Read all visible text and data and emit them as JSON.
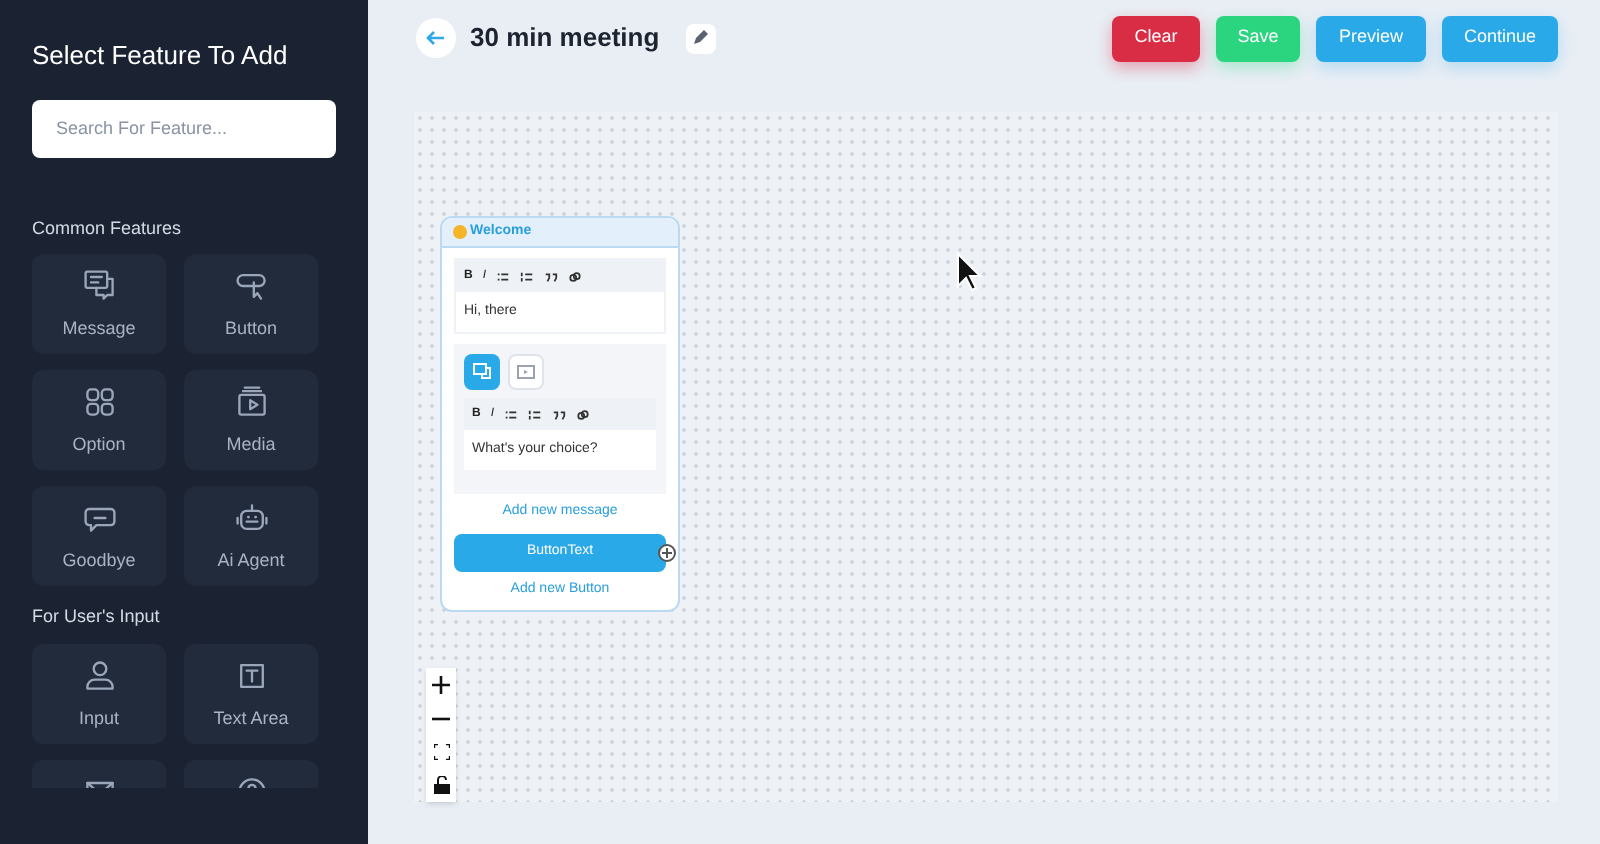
{
  "sidebar": {
    "title": "Select Feature To Add",
    "search": {
      "placeholder": "Search For Feature..."
    },
    "sections": [
      {
        "title": "Common Features",
        "items": [
          {
            "label": "Message",
            "kind": "message"
          },
          {
            "label": "Button",
            "kind": "button"
          },
          {
            "label": "Option",
            "kind": "option"
          },
          {
            "label": "Media",
            "kind": "media"
          },
          {
            "label": "Goodbye",
            "kind": "goodbye"
          },
          {
            "label": "Ai Agent",
            "kind": "agent"
          }
        ]
      },
      {
        "title": "For User's Input",
        "items": [
          {
            "label": "Input",
            "kind": "input"
          },
          {
            "label": "Text Area",
            "kind": "textarea"
          },
          {
            "kind": "email"
          },
          {
            "kind": "question"
          }
        ]
      }
    ]
  },
  "header": {
    "title": "30 min meeting",
    "buttons": [
      {
        "label": "Clear",
        "kind": "danger"
      },
      {
        "label": "Save",
        "kind": "success"
      },
      {
        "label": "Preview",
        "kind": "primary"
      },
      {
        "label": "Continue",
        "kind": "primary"
      }
    ]
  },
  "node": {
    "title": "Welcome",
    "editor": {
      "tools": [
        "B",
        "I"
      ],
      "text": "Hi, there"
    },
    "tabs": [
      {
        "kind": "message",
        "selected": true
      },
      {
        "kind": "media",
        "selected": false
      }
    ],
    "inner_editor": {
      "tools": [
        "B",
        "I"
      ],
      "text": "What's your choice?"
    },
    "add_message": "Add new message",
    "button_text": "ButtonText",
    "add_button": "Add new Button"
  }
}
